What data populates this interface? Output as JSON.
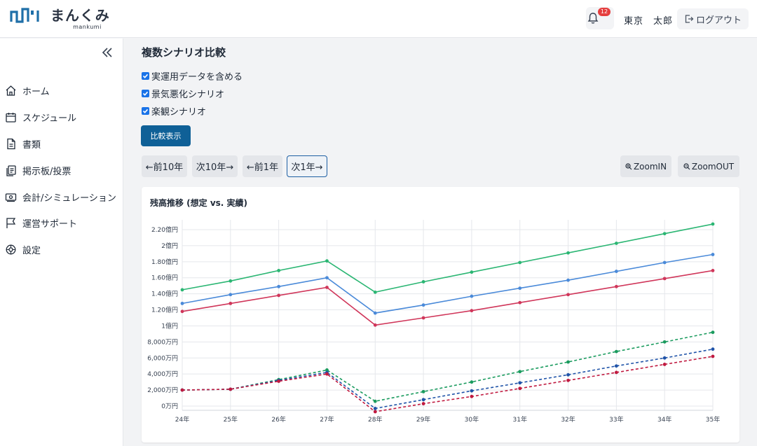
{
  "header": {
    "logo_text": "まんくみ",
    "logo_sub": "mankumi",
    "notification_count": "12",
    "user_name": "東京　太郎",
    "logout_label": "ログアウト"
  },
  "sidebar": {
    "items": [
      {
        "label": "ホーム",
        "icon": "home-icon"
      },
      {
        "label": "スケジュール",
        "icon": "calendar-icon"
      },
      {
        "label": "書類",
        "icon": "document-icon"
      },
      {
        "label": "掲示板/投票",
        "icon": "clipboard-icon"
      },
      {
        "label": "会計/シミュレーション",
        "icon": "money-icon"
      },
      {
        "label": "運営サポート",
        "icon": "flag-icon"
      },
      {
        "label": "設定",
        "icon": "settings-icon"
      }
    ]
  },
  "main": {
    "title": "複数シナリオ比較",
    "checkboxes": [
      {
        "label": "実運用データを含める",
        "checked": true
      },
      {
        "label": "景気悪化シナリオ",
        "checked": true
      },
      {
        "label": "楽観シナリオ",
        "checked": true
      }
    ],
    "compare_button": "比較表示",
    "nav_buttons": [
      "←前10年",
      "次10年→",
      "←前1年",
      "次1年→"
    ],
    "zoom_in": "ZoomIN",
    "zoom_out": "ZoomOUT"
  },
  "colors": {
    "accent": "#0f6097",
    "green": "#2bb673",
    "blue": "#4a8ad9",
    "red": "#d0365a",
    "green_dark": "#1a9b5e",
    "blue_dark": "#1f53a8",
    "red_dark": "#c0193f"
  },
  "chart_data": {
    "type": "line",
    "title": "残高推移 (想定 vs. 実績)",
    "x": [
      "24年",
      "25年",
      "26年",
      "27年",
      "28年",
      "29年",
      "30年",
      "31年",
      "32年",
      "33年",
      "34年",
      "35年"
    ],
    "y_tick_labels": [
      "0万円",
      "2,000万円",
      "4,000万円",
      "6,000万円",
      "8,000万円",
      "1億円",
      "1.20億円",
      "1.40億円",
      "1.60億円",
      "1.80億円",
      "2億円",
      "2.20億円"
    ],
    "y_unit": "万円",
    "ylim": [
      0,
      22000
    ],
    "grid": true,
    "series": [
      {
        "style": "solid",
        "color_key": "green",
        "values": [
          14500,
          15600,
          16900,
          18100,
          14200,
          15500,
          16700,
          17900,
          19100,
          20300,
          21500,
          22700
        ]
      },
      {
        "style": "solid",
        "color_key": "blue",
        "values": [
          12800,
          13900,
          14900,
          16000,
          11600,
          12600,
          13700,
          14700,
          15700,
          16800,
          17900,
          18900
        ]
      },
      {
        "style": "solid",
        "color_key": "red",
        "values": [
          11800,
          12800,
          13800,
          14800,
          10100,
          11000,
          11900,
          12900,
          13900,
          14900,
          15900,
          16900
        ]
      },
      {
        "style": "dashed",
        "color_key": "green_dark",
        "values": [
          2000,
          2100,
          3300,
          4500,
          600,
          1800,
          3000,
          4300,
          5500,
          6800,
          8000,
          9200
        ]
      },
      {
        "style": "dashed",
        "color_key": "blue_dark",
        "values": [
          2000,
          2100,
          3200,
          4200,
          -300,
          800,
          1900,
          2900,
          3900,
          5000,
          6000,
          7100
        ]
      },
      {
        "style": "dashed",
        "color_key": "red_dark",
        "values": [
          2000,
          2100,
          3100,
          4000,
          -700,
          300,
          1200,
          2200,
          3200,
          4200,
          5200,
          6200
        ]
      }
    ]
  }
}
